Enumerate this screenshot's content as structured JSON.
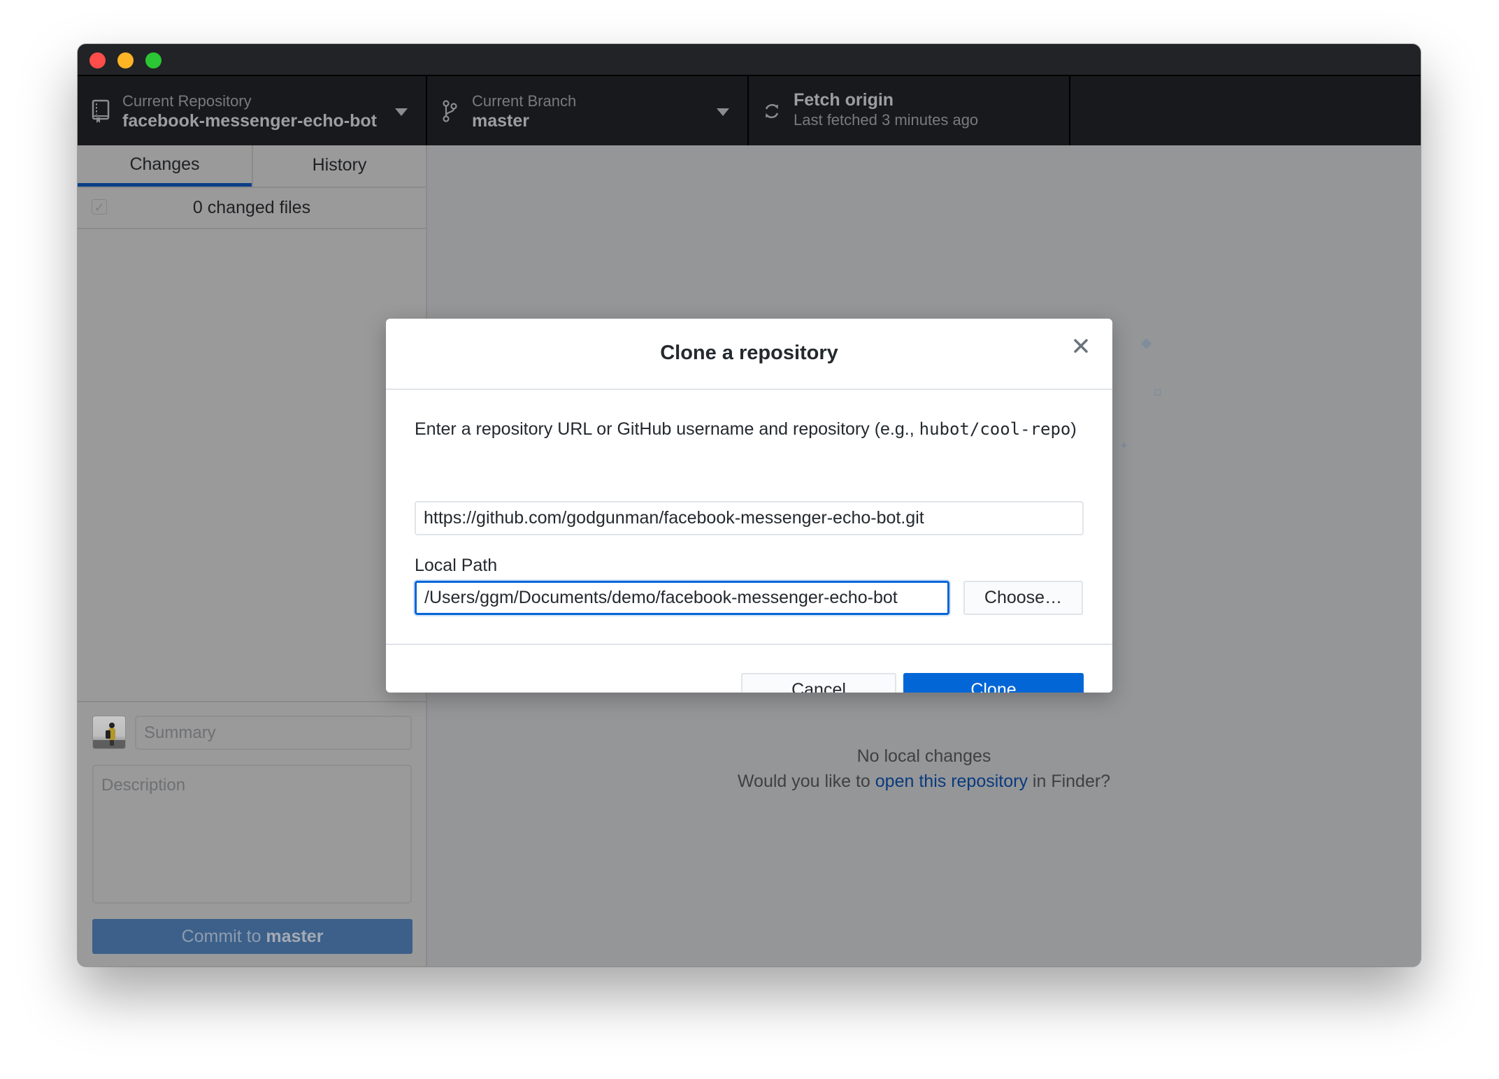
{
  "window": {
    "traffic_lights": [
      "close",
      "minimize",
      "maximize"
    ]
  },
  "toolbar": {
    "repository": {
      "label": "Current Repository",
      "value": "facebook-messenger-echo-bot",
      "icon": "repo-book-icon"
    },
    "branch": {
      "label": "Current Branch",
      "value": "master",
      "icon": "git-branch-icon"
    },
    "fetch": {
      "title": "Fetch origin",
      "subtitle": "Last fetched 3 minutes ago",
      "icon": "sync-icon"
    }
  },
  "sidebar": {
    "tabs": [
      {
        "label": "Changes",
        "active": true
      },
      {
        "label": "History",
        "active": false
      }
    ],
    "changed_files_label": "0 changed files",
    "select_all_checked": true,
    "commit": {
      "summary_placeholder": "Summary",
      "description_placeholder": "Description",
      "button_prefix": "Commit to ",
      "button_branch": "master"
    }
  },
  "main": {
    "no_changes_title": "No local changes",
    "open_prompt_before": "Would you like to ",
    "open_prompt_link": "open this repository",
    "open_prompt_after": " in Finder?"
  },
  "dialog": {
    "title": "Clone a repository",
    "prompt_text": "Enter a repository URL or GitHub username and repository (e.g., ",
    "prompt_code": "hubot/cool-repo",
    "prompt_close": ")",
    "url_value": "https://github.com/godgunman/facebook-messenger-echo-bot.git",
    "local_path_label": "Local Path",
    "local_path_value": "/Users/ggm/Documents/demo/facebook-messenger-echo-bot",
    "choose_label": "Choose…",
    "cancel_label": "Cancel",
    "clone_label": "Clone"
  },
  "colors": {
    "accent": "#0366d6",
    "tab_underline": "#0a3f86",
    "toolbar_bg": "#17191c",
    "overlay_bg": "#959698"
  }
}
